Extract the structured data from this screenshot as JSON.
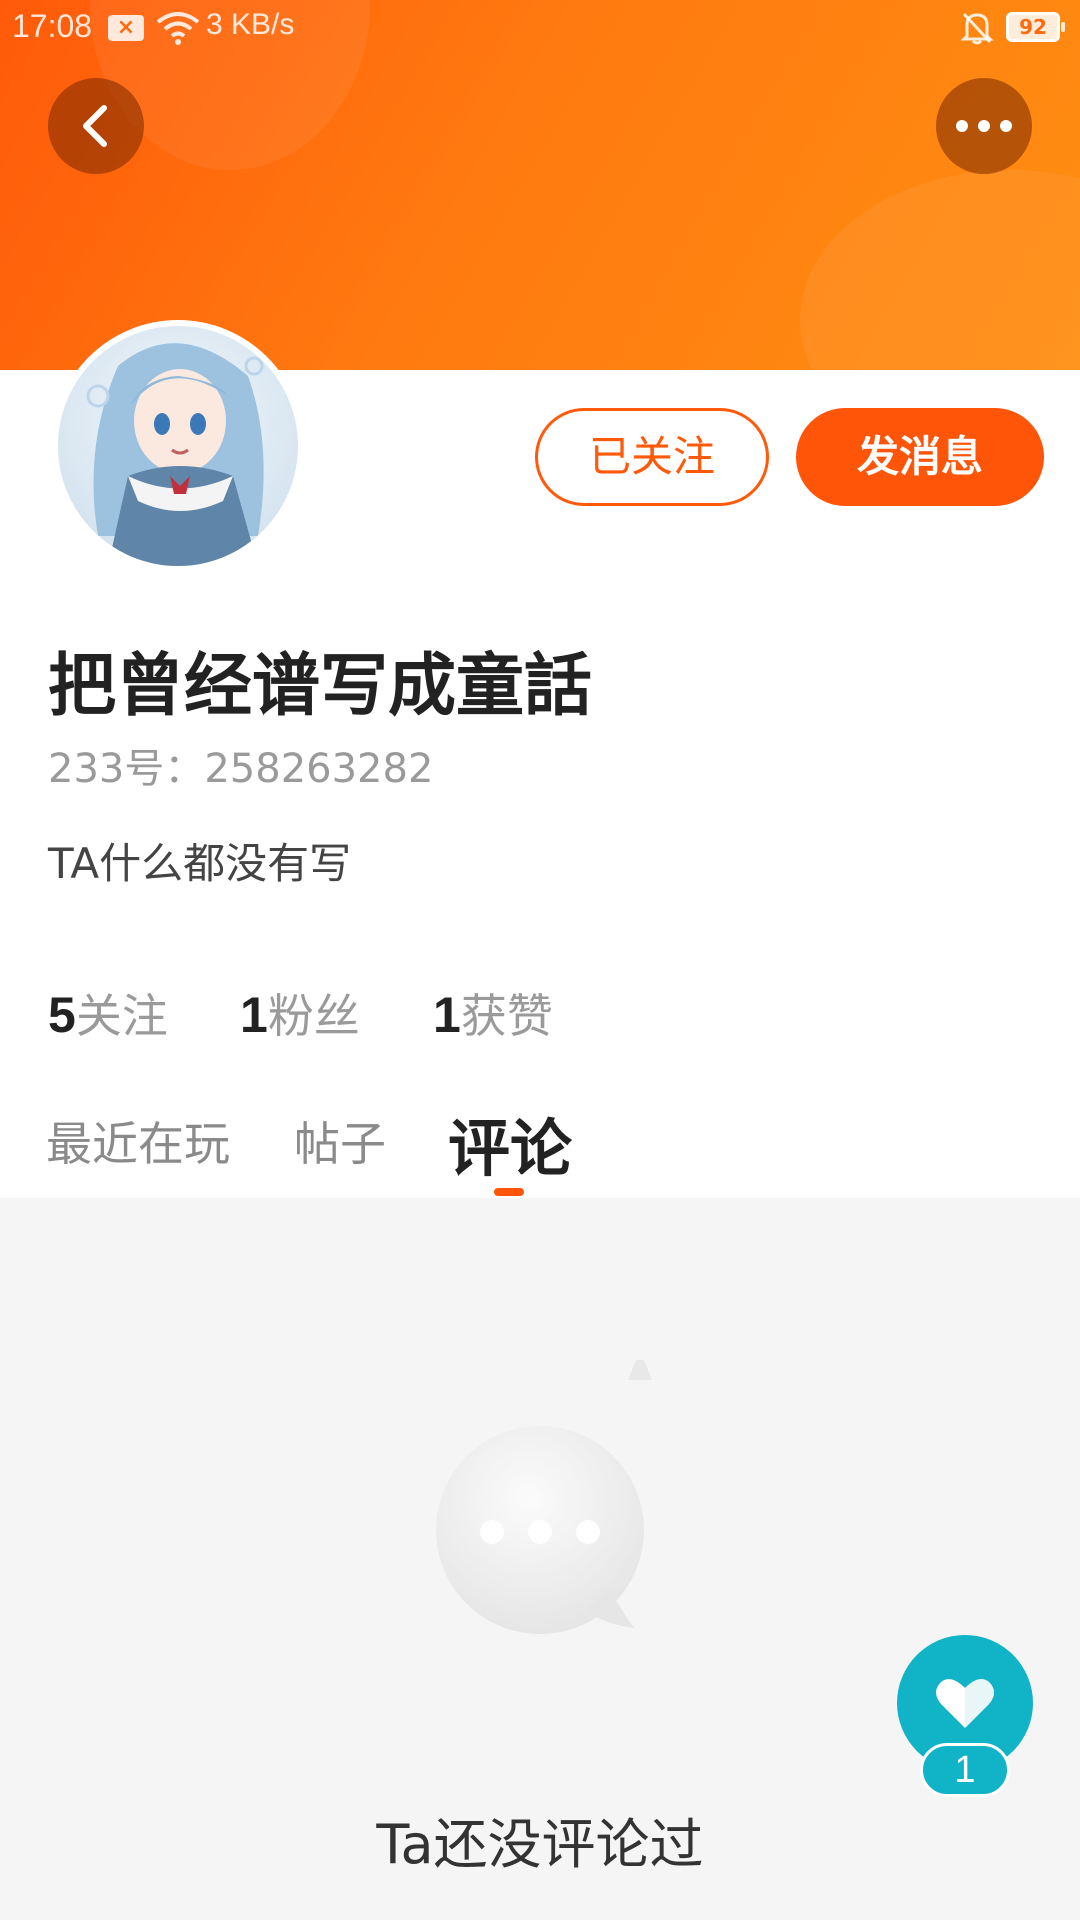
{
  "status_bar": {
    "time": "17:08",
    "network_speed": "3 KB/s",
    "battery": "92"
  },
  "header": {
    "back_icon": "chevron-left-icon",
    "more_icon": "more-horizontal-icon"
  },
  "profile": {
    "follow_label": "已关注",
    "message_label": "发消息",
    "nickname": "把曾经谱写成童話",
    "uid": "233号：258263282",
    "bio": "TA什么都没有写"
  },
  "stats": [
    {
      "count": "5",
      "label": "关注"
    },
    {
      "count": "1",
      "label": "粉丝"
    },
    {
      "count": "1",
      "label": "获赞"
    }
  ],
  "tabs": [
    {
      "label": "最近在玩",
      "active": false
    },
    {
      "label": "帖子",
      "active": false
    },
    {
      "label": "评论",
      "active": true
    }
  ],
  "empty_state": {
    "text": "Ta还没评论过"
  },
  "like_fab": {
    "count": "1"
  },
  "colors": {
    "accent": "#ff5508",
    "fab": "#11b3c7"
  }
}
